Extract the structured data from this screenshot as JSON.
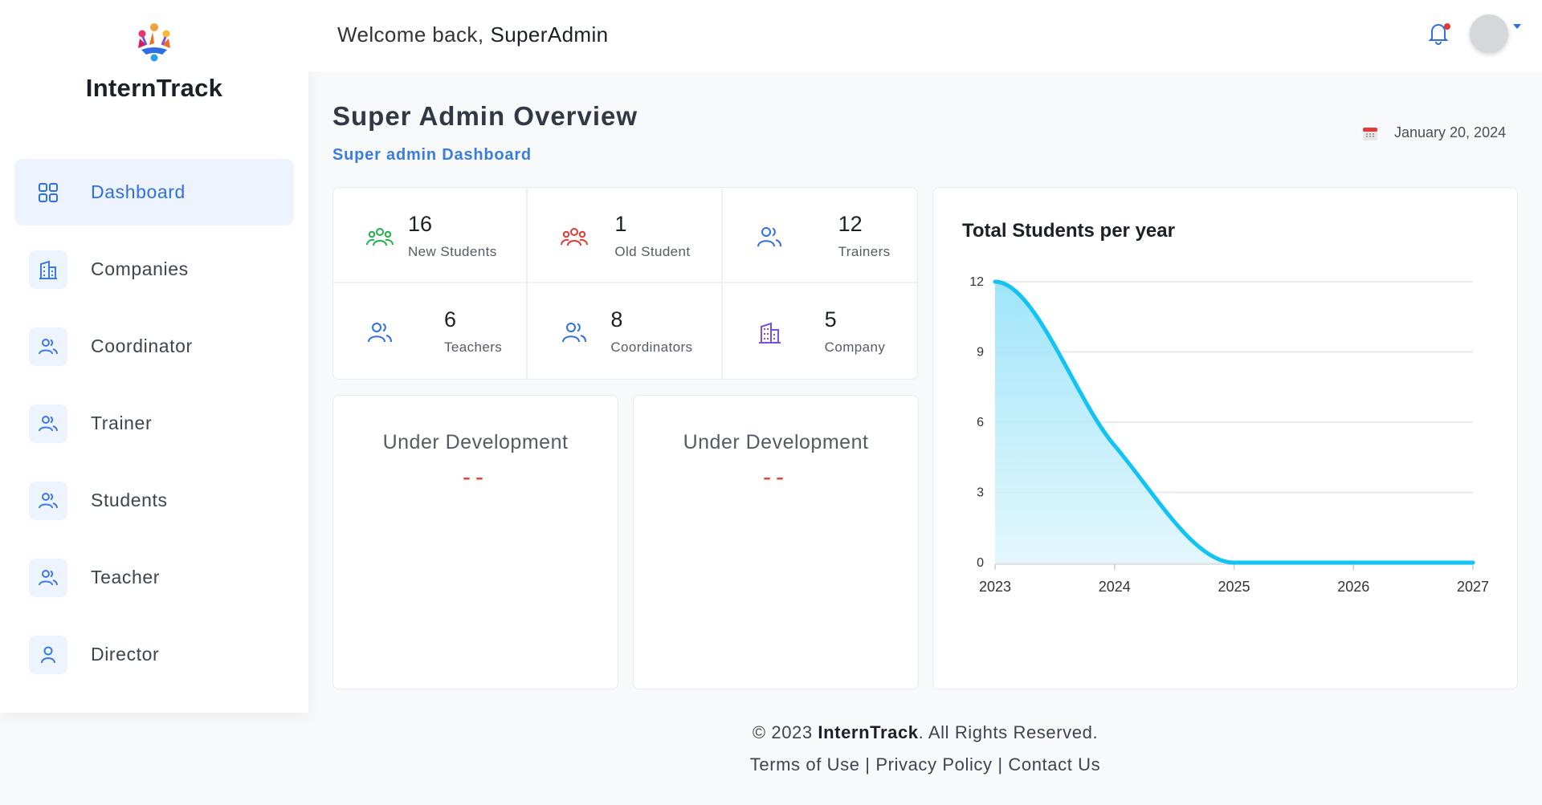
{
  "app": {
    "name": "InternTrack"
  },
  "colors": {
    "accent": "#2f6fe4",
    "chart_line": "#12c3f4",
    "alert": "#e53935"
  },
  "sidebar": {
    "items": [
      {
        "label": "Dashboard",
        "icon": "grid-icon",
        "active": true
      },
      {
        "label": "Companies",
        "icon": "building-icon"
      },
      {
        "label": "Coordinator",
        "icon": "users-icon"
      },
      {
        "label": "Trainer",
        "icon": "users-icon"
      },
      {
        "label": "Students",
        "icon": "users-icon"
      },
      {
        "label": "Teacher",
        "icon": "users-icon"
      },
      {
        "label": "Director",
        "icon": "user-icon"
      }
    ]
  },
  "header": {
    "welcome": "Welcome back,",
    "user": "SuperAdmin",
    "icons": [
      "bell-icon",
      "avatar",
      "caret-down-icon"
    ]
  },
  "page": {
    "title": "Super Admin Overview",
    "subtitle": "Super admin Dashboard",
    "date": "January 20, 2024"
  },
  "stats": [
    {
      "value": "16",
      "label": "New Students",
      "icon": "group-icon",
      "color": "#22b14c"
    },
    {
      "value": "1",
      "label": "Old Student",
      "icon": "group-icon",
      "color": "#e53935"
    },
    {
      "value": "12",
      "label": "Trainers",
      "icon": "users-icon",
      "color": "#2f6fe4"
    },
    {
      "value": "6",
      "label": "Teachers",
      "icon": "users-icon",
      "color": "#2f6fe4"
    },
    {
      "value": "8",
      "label": "Coordinators",
      "icon": "users-icon",
      "color": "#2f6fe4"
    },
    {
      "value": "5",
      "label": "Company",
      "icon": "building-icon",
      "color": "#7b4fe0"
    }
  ],
  "dev_cards": [
    {
      "title": "Under Development",
      "dash": "--"
    },
    {
      "title": "Under Development",
      "dash": "--"
    }
  ],
  "chart_data": {
    "type": "area",
    "title": "Total Students per year",
    "xlabel": "",
    "ylabel": "",
    "x": [
      2023,
      2024,
      2025,
      2026,
      2027
    ],
    "series": [
      {
        "values": [
          12,
          5,
          0,
          0,
          0
        ]
      }
    ],
    "x_ticks": [
      "2023",
      "2024",
      "2025",
      "2026",
      "2027"
    ],
    "y_ticks": [
      "0",
      "3",
      "6",
      "9",
      "12"
    ],
    "ylim": [
      0,
      12
    ],
    "grid": true
  },
  "footer": {
    "copyright_prefix": "© 2023 ",
    "brand": "InternTrack",
    "copyright_suffix": ". All Rights Reserved.",
    "links": [
      "Terms of Use",
      "Privacy Policy",
      "Contact Us"
    ],
    "separator": " | "
  }
}
